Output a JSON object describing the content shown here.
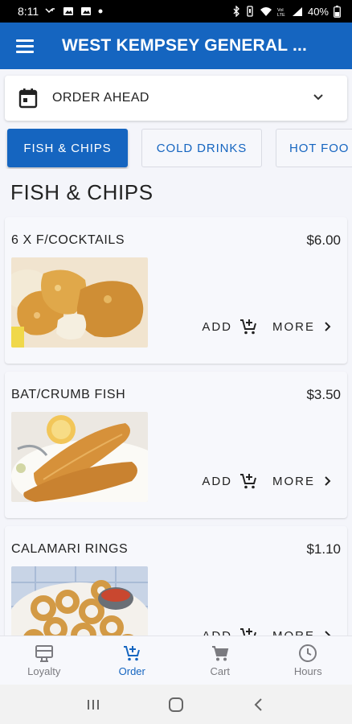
{
  "status_bar": {
    "time": "8:11",
    "battery": "40%",
    "left_icons": [
      "missed-call-icon",
      "image-icon",
      "image-icon",
      "dot-icon"
    ],
    "right_icons": [
      "bluetooth-icon",
      "vibrate-icon",
      "wifi-icon",
      "volte-icon",
      "signal-icon",
      "battery-icon"
    ]
  },
  "app_bar": {
    "title": "WEST KEMPSEY GENERAL ...",
    "menu_icon": "menu-icon"
  },
  "order_selector": {
    "label": "ORDER AHEAD",
    "icon": "calendar-icon",
    "trailing_icon": "chevron-down-icon"
  },
  "tabs": [
    {
      "label": "FISH & CHIPS",
      "active": true
    },
    {
      "label": "COLD DRINKS",
      "active": false
    },
    {
      "label": "HOT FOO",
      "active": false
    }
  ],
  "section_title": "FISH & CHIPS",
  "items": [
    {
      "name": "6 X F/COCKTAILS",
      "price": "$6.00",
      "add_label": "ADD",
      "more_label": "MORE"
    },
    {
      "name": "BAT/CRUMB FISH",
      "price": "$3.50",
      "add_label": "ADD",
      "more_label": "MORE"
    },
    {
      "name": "CALAMARI RINGS",
      "price": "$1.10",
      "add_label": "ADD",
      "more_label": "MORE"
    }
  ],
  "bottom_nav": [
    {
      "label": "Loyalty",
      "icon": "loyalty-icon",
      "active": false
    },
    {
      "label": "Order",
      "icon": "add-cart-icon",
      "active": true
    },
    {
      "label": "Cart",
      "icon": "cart-icon",
      "active": false
    },
    {
      "label": "Hours",
      "icon": "clock-icon",
      "active": false
    }
  ],
  "system_nav": [
    "recents-button",
    "home-button",
    "back-button"
  ],
  "colors": {
    "primary": "#1565c0",
    "background": "#f4f5fa",
    "card": "#f7f8fc",
    "inactive": "#7b7b80"
  }
}
